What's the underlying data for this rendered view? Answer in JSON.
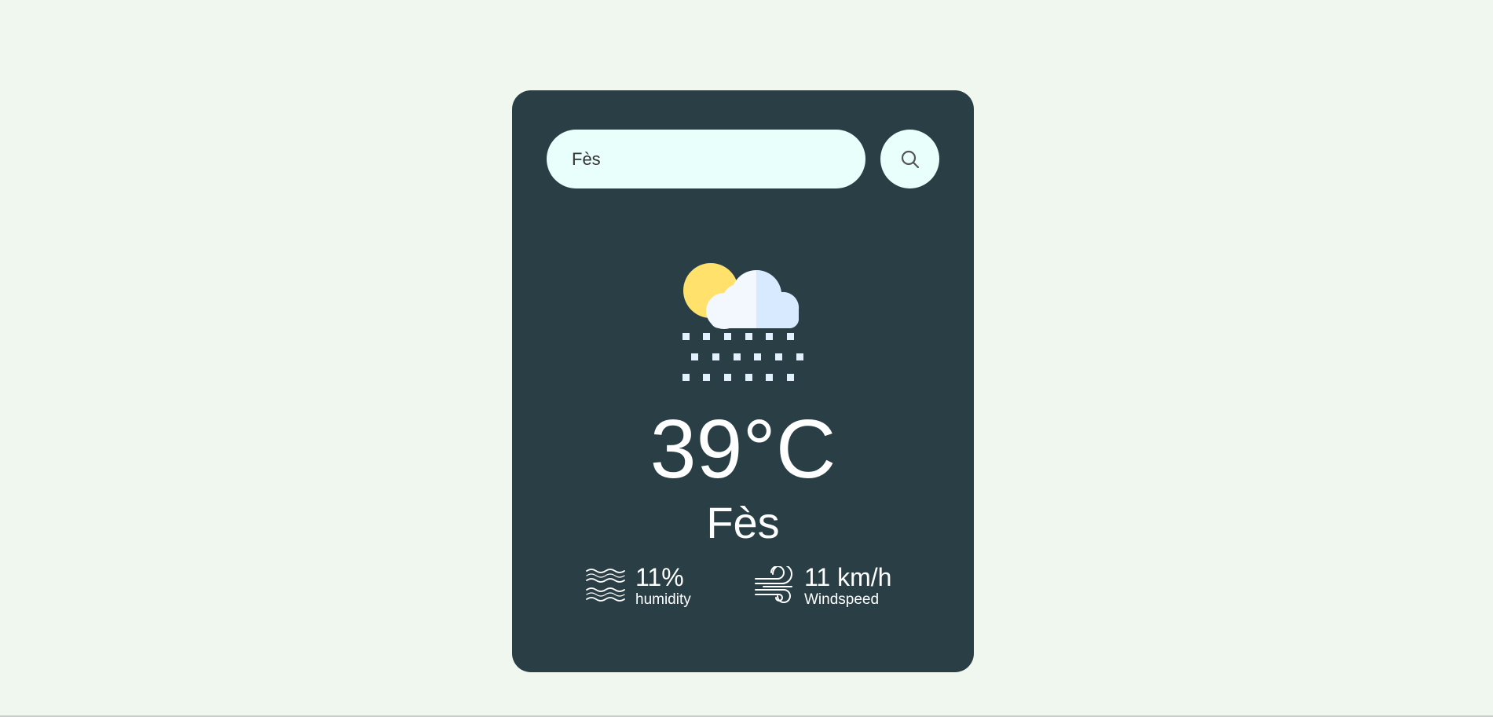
{
  "search": {
    "value": "Fès",
    "placeholder": "",
    "button_icon": "search-icon"
  },
  "weather": {
    "icon": "snow-cloud-sun-icon",
    "temperature": "39°C",
    "city": "Fès"
  },
  "details": {
    "humidity": {
      "icon": "humidity-waves-icon",
      "value": "11%",
      "label": "humidity"
    },
    "wind": {
      "icon": "wind-icon",
      "value": "11 km/h",
      "label": "Windspeed"
    }
  },
  "colors": {
    "page_background": "#f0f7ef",
    "card_background": "#2a3e46",
    "input_background": "#e9fffb",
    "text": "#ffffff",
    "sun": "#ffe16b",
    "cloud_light": "#f2f8fd",
    "cloud_shade": "#d8eaff",
    "snow": "#e3f0fd"
  }
}
